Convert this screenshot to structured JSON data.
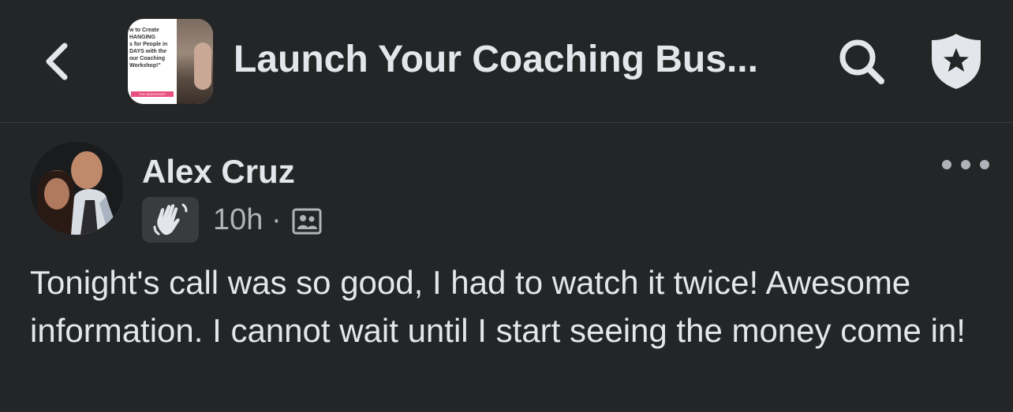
{
  "header": {
    "title": "Launch Your Coaching Bus...",
    "thumbnail_text": "w to Create\nHANGING\ns for People in\nDAYS with the\nour Coaching\nWorkshop!\"",
    "thumbnail_cta": "THE WORKSHOP!",
    "icons": {
      "back": "chevron-left-icon",
      "search": "search-icon",
      "admin": "shield-star-icon"
    }
  },
  "post": {
    "author": "Alex Cruz",
    "time": "10h",
    "separator": "·",
    "badge_icon": "waving-hand-icon",
    "privacy_icon": "group-members-icon",
    "body": "Tonight's call was so good, I had to watch it twice! Awesome information. I cannot wait until I start seeing the money come in!",
    "more_icon": "more-horizontal-icon"
  },
  "colors": {
    "background": "#242526",
    "primary_text": "#e4e6eb",
    "secondary_text": "#b0b3b8",
    "badge_bg": "#3a3b3c"
  }
}
